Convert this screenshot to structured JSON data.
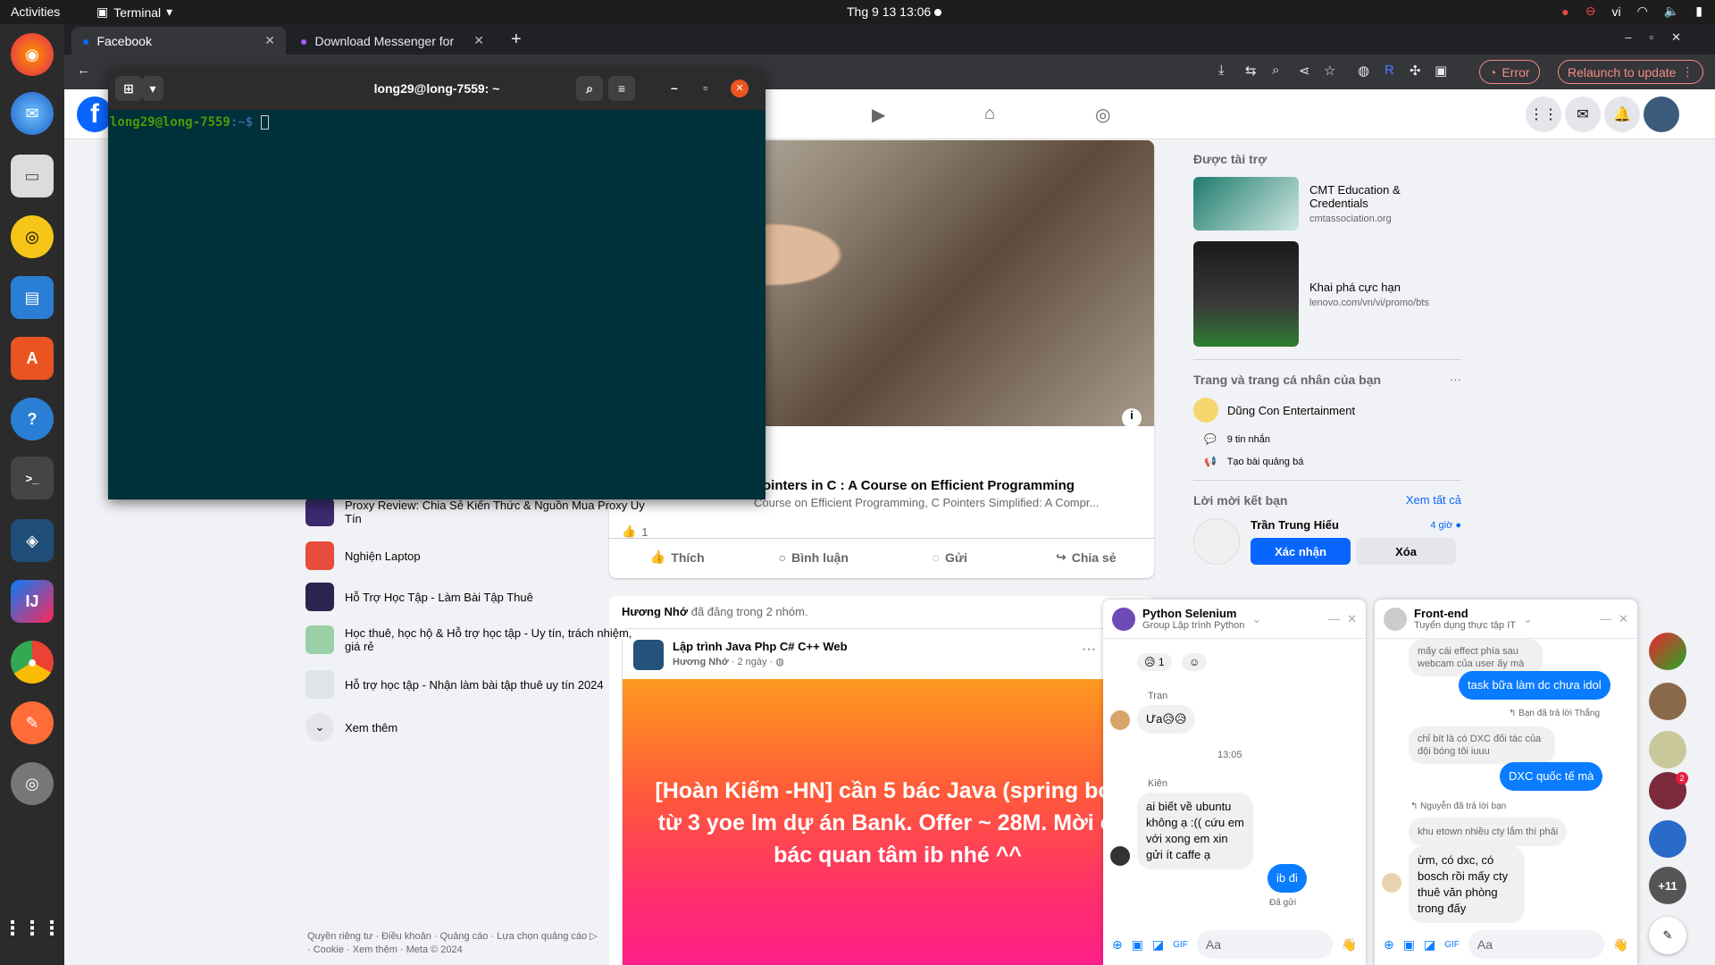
{
  "topbar": {
    "activities": "Activities",
    "app": "Terminal",
    "clock": "Thg 9 13  13:06",
    "lang": "vi"
  },
  "browser": {
    "tabs": [
      {
        "label": "Facebook"
      },
      {
        "label": "Download Messenger for"
      }
    ],
    "error_label": "Error",
    "relaunch_label": "Relaunch to update"
  },
  "terminal": {
    "title": "long29@long-7559: ~",
    "prompt_user": "long29@long-7559",
    "prompt_path": ":~$"
  },
  "feed": {
    "post_title": "Pointers in C : A Course on Efficient Programming",
    "post_sub": "Course on Efficient Programming, C Pointers Simplified: A Compr...",
    "like_count": "1",
    "actions": [
      "Thích",
      "Bình luận",
      "Gửi",
      "Chia sẻ"
    ],
    "shared_by": "Hương Nhớ",
    "shared_text": " đã đăng trong 2 nhóm.",
    "group_name": "Lập trình Java Php C# C++ Web",
    "group_author": "Hương Nhớ",
    "group_time": " · 2 ngày · ",
    "promo_text": "[Hoàn Kiếm -HN] cần 5 bác Java (spring boot) từ 3 yoe lm dự án Bank. Offer ~ 28M. Mời các bác quan tâm ib nhé ^^"
  },
  "left": {
    "items": [
      {
        "label": "Proxy Review: Chia Sẻ Kiến Thức & Nguồn Mua Proxy Uy Tín"
      },
      {
        "label": "Nghiện Laptop"
      },
      {
        "label": "Hỗ Trợ Học Tập - Làm Bài Tập Thuê"
      },
      {
        "label": "Học thuê, học hộ & Hỗ trợ học tập - Uy tín, trách nhiệm, giá rẻ"
      },
      {
        "label": "Hỗ trợ học tập - Nhận làm bài tập thuê uy tín 2024"
      }
    ],
    "more": "Xem thêm",
    "footer": "Quyền riêng tư · Điều khoản · Quảng cáo · Lựa chọn quảng cáo ▷ · Cookie · Xem thêm · Meta © 2024"
  },
  "right": {
    "sponsored": "Được tài trợ",
    "ads": [
      {
        "title": "CMT Education & Credentials",
        "url": "cmtassociation.org"
      },
      {
        "title": "Khai phá cực hạn",
        "url": "lenovo.com/vn/vi/promo/bts"
      }
    ],
    "pages_title": "Trang và trang cá nhân của bạn",
    "page_name": "Dũng Con Entertainment",
    "messages": "9 tin nhắn",
    "create_ad": "Tạo bài quảng bá",
    "friend_title": "Lời mời kết bạn",
    "see_all": "Xem tất cả",
    "friend_name": "Trần Trung Hiếu",
    "friend_time": "4 giờ",
    "confirm": "Xác nhận",
    "delete": "Xóa"
  },
  "chat1": {
    "name": "Python Selenium",
    "sub": "Group Lập trình Python",
    "react_count": "1",
    "sender1": "Tran",
    "msg1": "Ưa😥😥",
    "time": "13:05",
    "sender2": "Kiên",
    "msg2": "ai biết về ubuntu không ạ :(( cứu em với xong em xin gửi ít caffe ạ",
    "out": "ib đi",
    "status": "Đã gửi",
    "placeholder": "Aa"
  },
  "chat2": {
    "name": "Front-end",
    "sub": "Tuyển dụng thực tập IT",
    "m1": "mấy cái effect phía sau webcam của user ấy mà",
    "o1": "task bữa làm dc chưa idol",
    "reply1": "Bạn đã trả lời Thắng",
    "m2": "chỉ bít là có DXC đối tác của đội bóng tôi iuuu",
    "o2": "DXC quốc tế mà",
    "reply2": "Nguyễn đã trả lời bạn",
    "m3": "khu etown nhiều cty lắm thì phải",
    "m4": "ừm, có dxc, có bosch rồi mấy cty thuê văn phòng trong đấy",
    "placeholder": "Aa"
  },
  "contacts": {
    "badge": "2",
    "more": "+11"
  }
}
